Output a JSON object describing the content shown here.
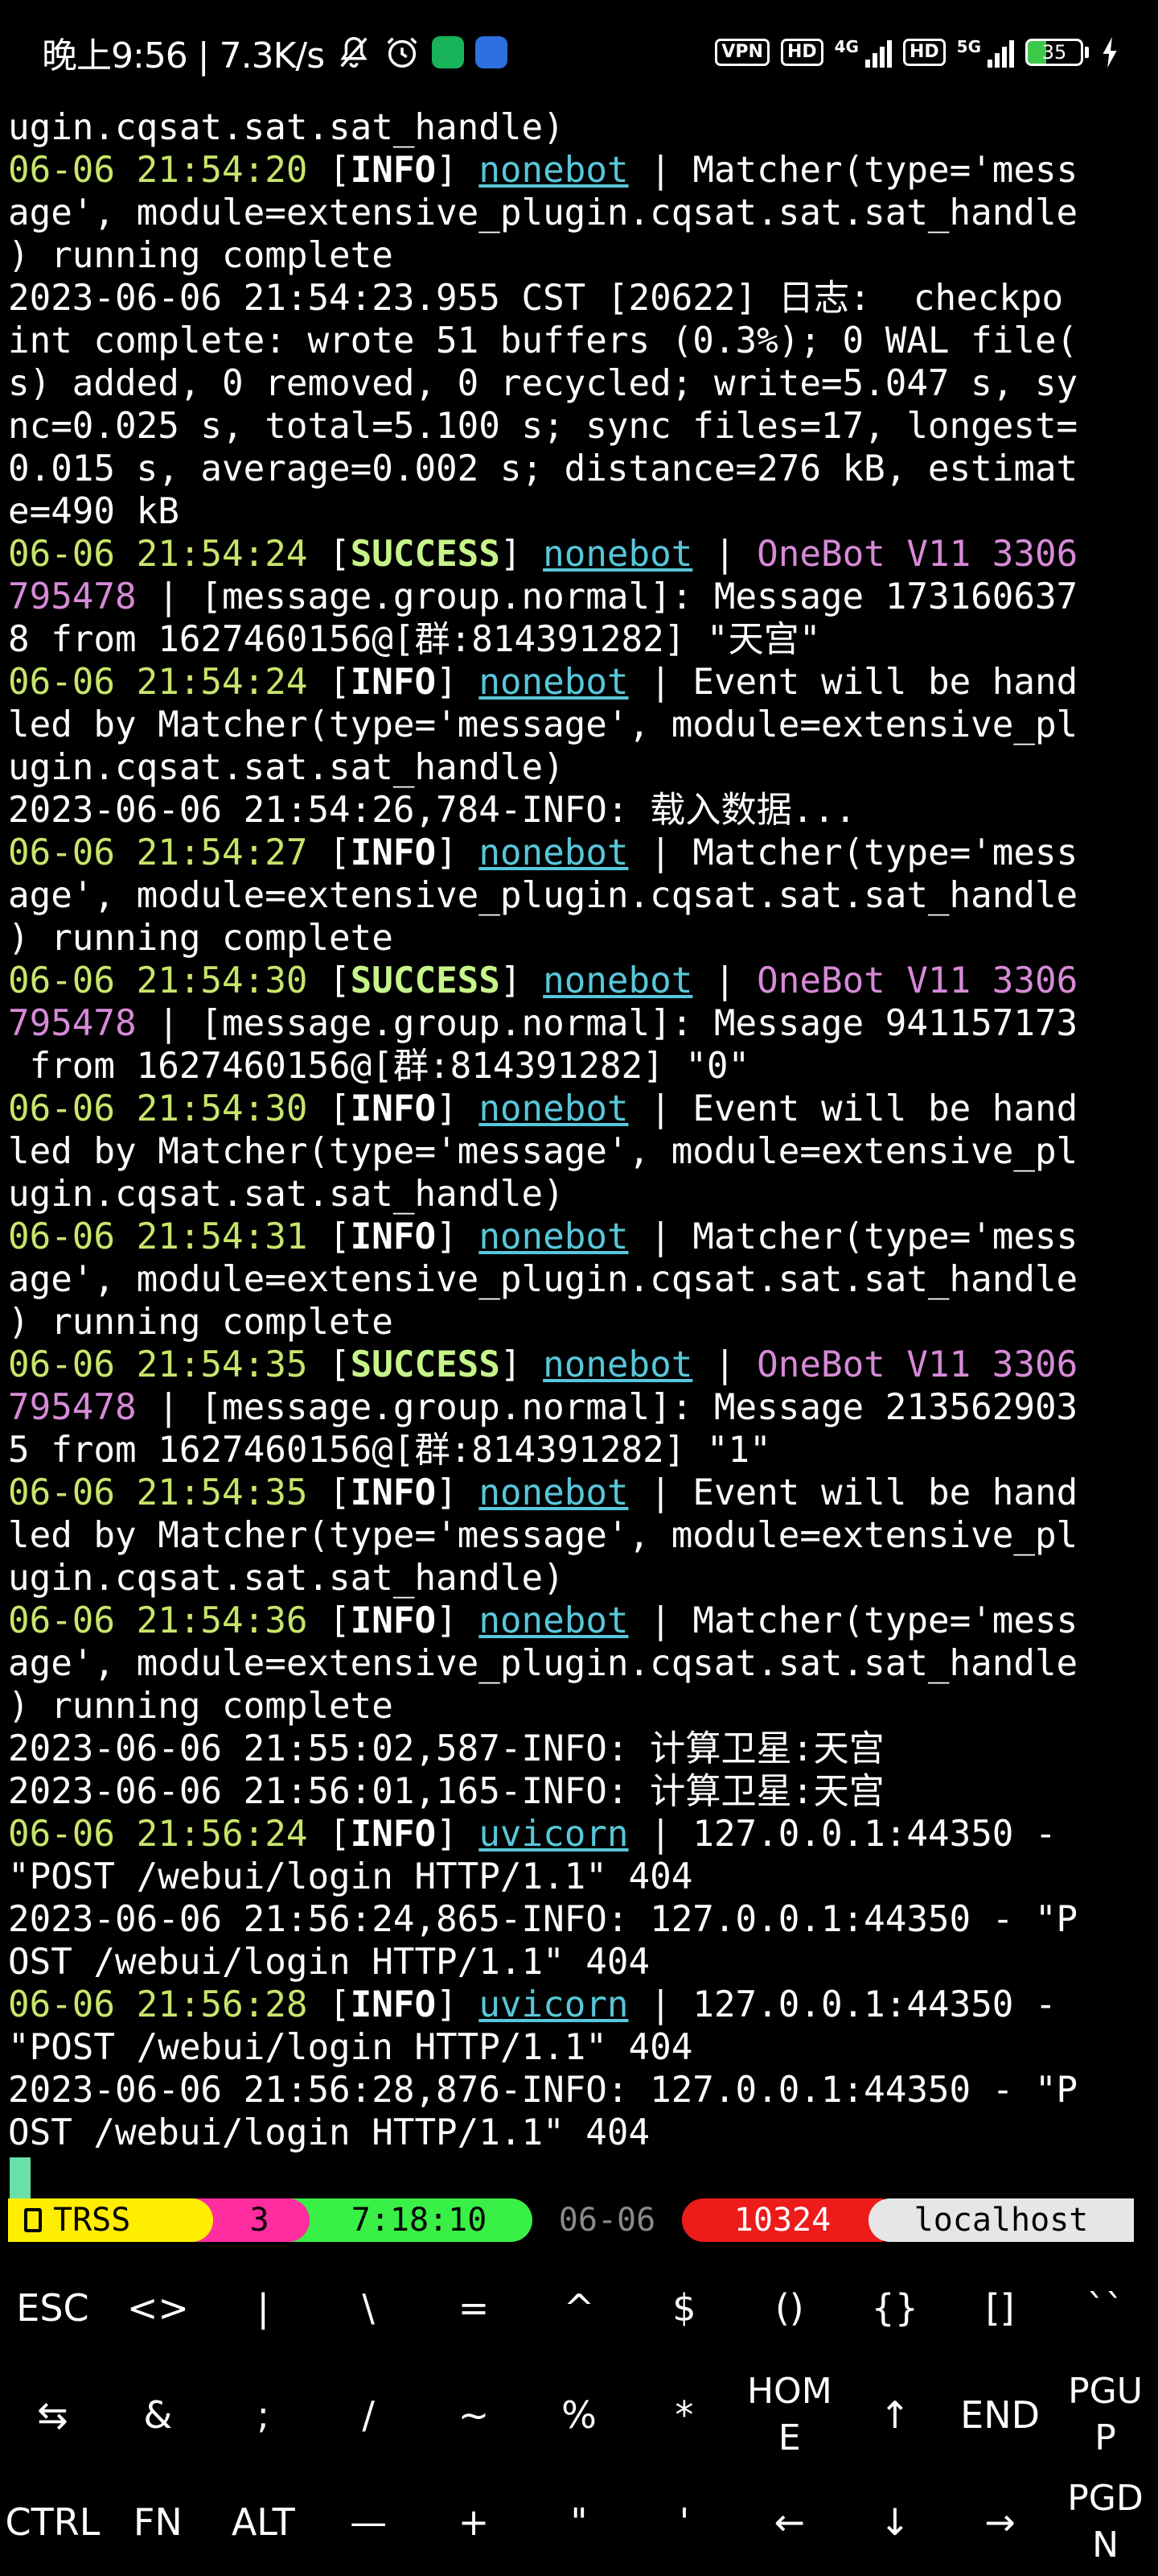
{
  "status_bar": {
    "time": "晚上9:56 | 7.3K/s",
    "vpn": "VPN",
    "hd1": "HD",
    "net1": "4G",
    "hd2": "HD",
    "net2": "5G",
    "battery": "35",
    "battery_level": 0.35,
    "icons": [
      "mute-bell-icon",
      "alarm-icon",
      "app-shield-icon",
      "app-bot-icon",
      "signal-icon",
      "battery-icon",
      "charging-bolt-icon"
    ]
  },
  "log_lines": [
    [
      {
        "t": "ugin.cqsat.sat.sat_handle)",
        "c": ""
      }
    ],
    [
      {
        "t": "06-06 21:54:20",
        "c": "time"
      },
      {
        "t": " [",
        "c": ""
      },
      {
        "t": "INFO",
        "c": "info"
      },
      {
        "t": "] ",
        "c": ""
      },
      {
        "t": "nonebot",
        "c": "logger"
      },
      {
        "t": " | Matcher(type='mess",
        "c": ""
      }
    ],
    [
      {
        "t": "age', module=extensive_plugin.cqsat.sat.sat_handle",
        "c": ""
      }
    ],
    [
      {
        "t": ") running complete",
        "c": ""
      }
    ],
    [
      {
        "t": "2023-06-06 21:54:23.955 CST [20622] 日志:  checkpo",
        "c": ""
      }
    ],
    [
      {
        "t": "int complete: wrote 51 buffers (0.3%); 0 WAL file(",
        "c": ""
      }
    ],
    [
      {
        "t": "s) added, 0 removed, 0 recycled; write=5.047 s, sy",
        "c": ""
      }
    ],
    [
      {
        "t": "nc=0.025 s, total=5.100 s; sync files=17, longest=",
        "c": ""
      }
    ],
    [
      {
        "t": "0.015 s, average=0.002 s; distance=276 kB, estimat",
        "c": ""
      }
    ],
    [
      {
        "t": "e=490 kB",
        "c": ""
      }
    ],
    [
      {
        "t": "06-06 21:54:24",
        "c": "time"
      },
      {
        "t": " [",
        "c": ""
      },
      {
        "t": "SUCCESS",
        "c": "success"
      },
      {
        "t": "] ",
        "c": ""
      },
      {
        "t": "nonebot",
        "c": "logger"
      },
      {
        "t": " | ",
        "c": ""
      },
      {
        "t": "OneBot V11 3306",
        "c": "adapter"
      }
    ],
    [
      {
        "t": "795478",
        "c": "adapter"
      },
      {
        "t": " | [message.group.normal]: Message 173160637",
        "c": ""
      }
    ],
    [
      {
        "t": "8 from 1627460156@[群:814391282] \"天宫\"",
        "c": ""
      }
    ],
    [
      {
        "t": "06-06 21:54:24",
        "c": "time"
      },
      {
        "t": " [",
        "c": ""
      },
      {
        "t": "INFO",
        "c": "info"
      },
      {
        "t": "] ",
        "c": ""
      },
      {
        "t": "nonebot",
        "c": "logger"
      },
      {
        "t": " | Event will be hand",
        "c": ""
      }
    ],
    [
      {
        "t": "led by Matcher(type='message', module=extensive_pl",
        "c": ""
      }
    ],
    [
      {
        "t": "ugin.cqsat.sat.sat_handle)",
        "c": ""
      }
    ],
    [
      {
        "t": "2023-06-06 21:54:26,784-INFO: 载入数据...",
        "c": ""
      }
    ],
    [
      {
        "t": "06-06 21:54:27",
        "c": "time"
      },
      {
        "t": " [",
        "c": ""
      },
      {
        "t": "INFO",
        "c": "info"
      },
      {
        "t": "] ",
        "c": ""
      },
      {
        "t": "nonebot",
        "c": "logger"
      },
      {
        "t": " | Matcher(type='mess",
        "c": ""
      }
    ],
    [
      {
        "t": "age', module=extensive_plugin.cqsat.sat.sat_handle",
        "c": ""
      }
    ],
    [
      {
        "t": ") running complete",
        "c": ""
      }
    ],
    [
      {
        "t": "06-06 21:54:30",
        "c": "time"
      },
      {
        "t": " [",
        "c": ""
      },
      {
        "t": "SUCCESS",
        "c": "success"
      },
      {
        "t": "] ",
        "c": ""
      },
      {
        "t": "nonebot",
        "c": "logger"
      },
      {
        "t": " | ",
        "c": ""
      },
      {
        "t": "OneBot V11 3306",
        "c": "adapter"
      }
    ],
    [
      {
        "t": "795478",
        "c": "adapter"
      },
      {
        "t": " | [message.group.normal]: Message 941157173",
        "c": ""
      }
    ],
    [
      {
        "t": " from 1627460156@[群:814391282] \"0\"",
        "c": ""
      }
    ],
    [
      {
        "t": "06-06 21:54:30",
        "c": "time"
      },
      {
        "t": " [",
        "c": ""
      },
      {
        "t": "INFO",
        "c": "info"
      },
      {
        "t": "] ",
        "c": ""
      },
      {
        "t": "nonebot",
        "c": "logger"
      },
      {
        "t": " | Event will be hand",
        "c": ""
      }
    ],
    [
      {
        "t": "led by Matcher(type='message', module=extensive_pl",
        "c": ""
      }
    ],
    [
      {
        "t": "ugin.cqsat.sat.sat_handle)",
        "c": ""
      }
    ],
    [
      {
        "t": "06-06 21:54:31",
        "c": "time"
      },
      {
        "t": " [",
        "c": ""
      },
      {
        "t": "INFO",
        "c": "info"
      },
      {
        "t": "] ",
        "c": ""
      },
      {
        "t": "nonebot",
        "c": "logger"
      },
      {
        "t": " | Matcher(type='mess",
        "c": ""
      }
    ],
    [
      {
        "t": "age', module=extensive_plugin.cqsat.sat.sat_handle",
        "c": ""
      }
    ],
    [
      {
        "t": ") running complete",
        "c": ""
      }
    ],
    [
      {
        "t": "06-06 21:54:35",
        "c": "time"
      },
      {
        "t": " [",
        "c": ""
      },
      {
        "t": "SUCCESS",
        "c": "success"
      },
      {
        "t": "] ",
        "c": ""
      },
      {
        "t": "nonebot",
        "c": "logger"
      },
      {
        "t": " | ",
        "c": ""
      },
      {
        "t": "OneBot V11 3306",
        "c": "adapter"
      }
    ],
    [
      {
        "t": "795478",
        "c": "adapter"
      },
      {
        "t": " | [message.group.normal]: Message 213562903",
        "c": ""
      }
    ],
    [
      {
        "t": "5 from 1627460156@[群:814391282] \"1\"",
        "c": ""
      }
    ],
    [
      {
        "t": "06-06 21:54:35",
        "c": "time"
      },
      {
        "t": " [",
        "c": ""
      },
      {
        "t": "INFO",
        "c": "info"
      },
      {
        "t": "] ",
        "c": ""
      },
      {
        "t": "nonebot",
        "c": "logger"
      },
      {
        "t": " | Event will be hand",
        "c": ""
      }
    ],
    [
      {
        "t": "led by Matcher(type='message', module=extensive_pl",
        "c": ""
      }
    ],
    [
      {
        "t": "ugin.cqsat.sat.sat_handle)",
        "c": ""
      }
    ],
    [
      {
        "t": "06-06 21:54:36",
        "c": "time"
      },
      {
        "t": " [",
        "c": ""
      },
      {
        "t": "INFO",
        "c": "info"
      },
      {
        "t": "] ",
        "c": ""
      },
      {
        "t": "nonebot",
        "c": "logger"
      },
      {
        "t": " | Matcher(type='mess",
        "c": ""
      }
    ],
    [
      {
        "t": "age', module=extensive_plugin.cqsat.sat.sat_handle",
        "c": ""
      }
    ],
    [
      {
        "t": ") running complete",
        "c": ""
      }
    ],
    [
      {
        "t": "2023-06-06 21:55:02,587-INFO: 计算卫星:天宫",
        "c": ""
      }
    ],
    [
      {
        "t": "2023-06-06 21:56:01,165-INFO: 计算卫星:天宫",
        "c": ""
      }
    ],
    [
      {
        "t": "06-06 21:56:24",
        "c": "time"
      },
      {
        "t": " [",
        "c": ""
      },
      {
        "t": "INFO",
        "c": "info"
      },
      {
        "t": "] ",
        "c": ""
      },
      {
        "t": "uvicorn",
        "c": "logger"
      },
      {
        "t": " | 127.0.0.1:44350 -",
        "c": ""
      }
    ],
    [
      {
        "t": "\"POST /webui/login HTTP/1.1\" 404",
        "c": ""
      }
    ],
    [
      {
        "t": "2023-06-06 21:56:24,865-INFO: 127.0.0.1:44350 - \"P",
        "c": ""
      }
    ],
    [
      {
        "t": "OST /webui/login HTTP/1.1\" 404",
        "c": ""
      }
    ],
    [
      {
        "t": "06-06 21:56:28",
        "c": "time"
      },
      {
        "t": " [",
        "c": ""
      },
      {
        "t": "INFO",
        "c": "info"
      },
      {
        "t": "] ",
        "c": ""
      },
      {
        "t": "uvicorn",
        "c": "logger"
      },
      {
        "t": " | 127.0.0.1:44350 -",
        "c": ""
      }
    ],
    [
      {
        "t": "\"POST /webui/login HTTP/1.1\" 404",
        "c": ""
      }
    ],
    [
      {
        "t": "2023-06-06 21:56:28,876-INFO: 127.0.0.1:44350 - \"P",
        "c": ""
      }
    ],
    [
      {
        "t": "OST /webui/login HTTP/1.1\" 404",
        "c": ""
      }
    ]
  ],
  "tmux_bar": {
    "session": "TRSS",
    "window": "3",
    "uptime": "7:18:10",
    "date": "06-06",
    "pid": "10324",
    "host": "localhost"
  },
  "extra_keys": [
    [
      "ESC",
      "<>",
      "|",
      "\\",
      "=",
      "^",
      "$",
      "()",
      "{}",
      "[]",
      "``"
    ],
    [
      "⇆",
      "&",
      ";",
      "/",
      "~",
      "%",
      "*",
      "HOM\nE",
      "↑",
      "END",
      "PGU\nP"
    ],
    [
      "CTRL",
      "FN",
      "ALT",
      "—",
      "+",
      "\"",
      "'",
      "←",
      "↓",
      "→",
      "PGD\nN"
    ]
  ],
  "colors": {
    "background": "#000000",
    "timestamp": "#c7e56b",
    "success": "#c7f48a",
    "logger": "#57c7d9",
    "adapter": "#d78ad7",
    "cursor": "#68e0a8"
  }
}
